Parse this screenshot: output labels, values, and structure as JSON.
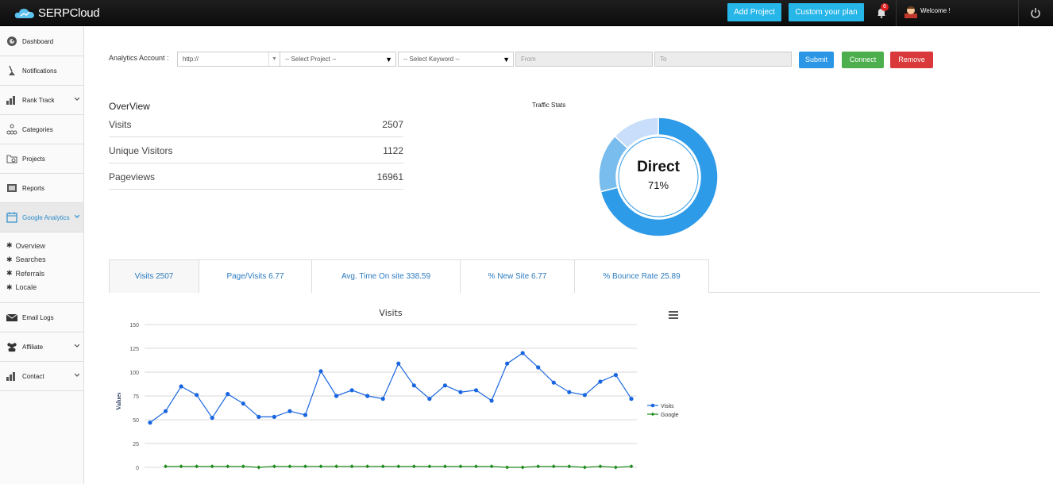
{
  "app": {
    "brand": "SERPCloud"
  },
  "topbar": {
    "add_project": "Add Project",
    "custom_plan": "Custom your plan",
    "notification_count": "6",
    "welcome": "Welcome !"
  },
  "sidebar": {
    "items": [
      {
        "label": "Dashboard",
        "icon": "dashboard-icon"
      },
      {
        "label": "Notifications",
        "icon": "satellite-icon"
      },
      {
        "label": "Rank Track",
        "icon": "bar-chart-icon"
      },
      {
        "label": "Categories",
        "icon": "hierarchy-icon"
      },
      {
        "label": "Projects",
        "icon": "folder-icon"
      },
      {
        "label": "Reports",
        "icon": "report-icon"
      },
      {
        "label": "Google Analytics",
        "icon": "calendar-icon"
      },
      {
        "label": "Email Logs",
        "icon": "envelope-icon"
      },
      {
        "label": "Affiliate",
        "icon": "users-icon"
      },
      {
        "label": "Contact",
        "icon": "bar-chart-icon"
      }
    ],
    "subnav": [
      "Overview",
      "Searches",
      "Referrals",
      "Locale"
    ]
  },
  "filters": {
    "account_label": "Analytics Account :",
    "account_value": "http://",
    "project": "-- Select Project --",
    "keyword": "-- Select Keyword --",
    "from_placeholder": "From",
    "to_placeholder": "To",
    "submit": "Submit",
    "connect": "Connect",
    "remove": "Remove",
    "colors": {
      "submit": "#2a96e5",
      "connect": "#4cae4c",
      "remove": "#d9393a"
    }
  },
  "overview": {
    "title": "OverView",
    "rows": [
      {
        "label": "Visits",
        "value": "2507"
      },
      {
        "label": "Unique Visitors",
        "value": "1122"
      },
      {
        "label": "Pageviews",
        "value": "16961"
      }
    ]
  },
  "traffic": {
    "title": "Traffic Stats",
    "center_label": "Direct",
    "center_value": "71%",
    "slices": [
      {
        "value": 71,
        "color": "#2e9be8"
      },
      {
        "value": 16,
        "color": "#79bcee"
      },
      {
        "value": 13,
        "color": "#c9defa"
      }
    ]
  },
  "tabs": [
    "Visits 2507",
    "Page/Visits  6.77",
    "Avg. Time On site  338.59",
    "% New Site  6.77",
    "% Bounce Rate  25.89"
  ],
  "chart_data": {
    "type": "line",
    "title": "Visits",
    "ylabel": "Values",
    "ylim": [
      0,
      150
    ],
    "yticks": [
      0,
      25,
      50,
      75,
      100,
      125,
      150
    ],
    "legend": "right",
    "grid": true,
    "series": [
      {
        "name": "Visits",
        "color": "#1a66e0",
        "values": [
          47,
          59,
          85,
          76,
          52,
          77,
          67,
          53,
          53,
          59,
          55,
          101,
          75,
          81,
          75,
          72,
          109,
          86,
          72,
          86,
          79,
          81,
          70,
          109,
          120,
          105,
          89,
          79,
          76,
          90,
          97,
          72
        ]
      },
      {
        "name": "Google",
        "color": "#1c8a1c",
        "values": [
          null,
          1,
          1,
          1,
          1,
          1,
          1,
          0,
          1,
          1,
          1,
          1,
          1,
          1,
          1,
          1,
          1,
          1,
          1,
          1,
          1,
          1,
          1,
          0,
          0,
          1,
          1,
          1,
          0,
          1,
          0,
          1
        ]
      }
    ]
  }
}
